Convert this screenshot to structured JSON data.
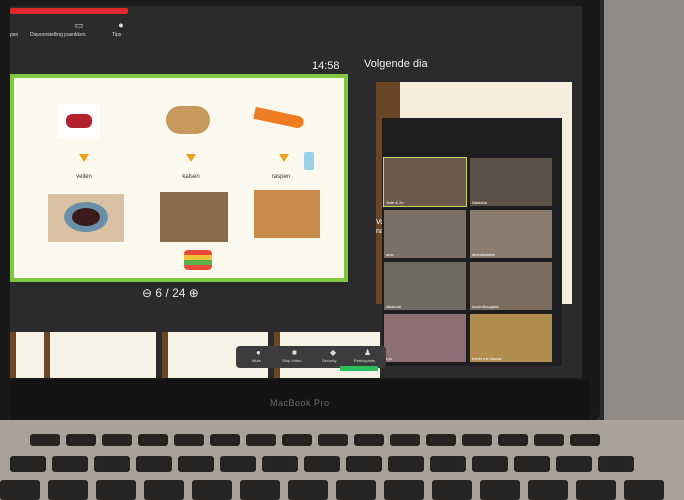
{
  "zoom_toolbar": {
    "item1": "pen",
    "item2": "Diavoorstelling pasnkken",
    "item3": "Tips"
  },
  "presenter": {
    "timer": "14:58",
    "next_slide_heading": "Volgende dia",
    "slide_counter": "6 / 24"
  },
  "current_slide": {
    "labels": [
      "veilen",
      "kalsen",
      "raspen"
    ]
  },
  "next_slide": {
    "text": [
      "Voor",
      "natu"
    ]
  },
  "gallery": {
    "names": [
      "Julie & Zo",
      "Natasha",
      "ame",
      "ahenatalaine",
      "stastone",
      "hazenthaugleis",
      "Lys",
      "hariet me Nacka"
    ]
  },
  "controls": {
    "labels": [
      "Mute",
      "Stop Video",
      "Security",
      "Participants"
    ]
  },
  "laptop_brand": "MacBook Pro",
  "colors": {
    "slide_border": "#7fc840",
    "recording": "#e0282a",
    "participants_badge": "#2bbd5a"
  }
}
